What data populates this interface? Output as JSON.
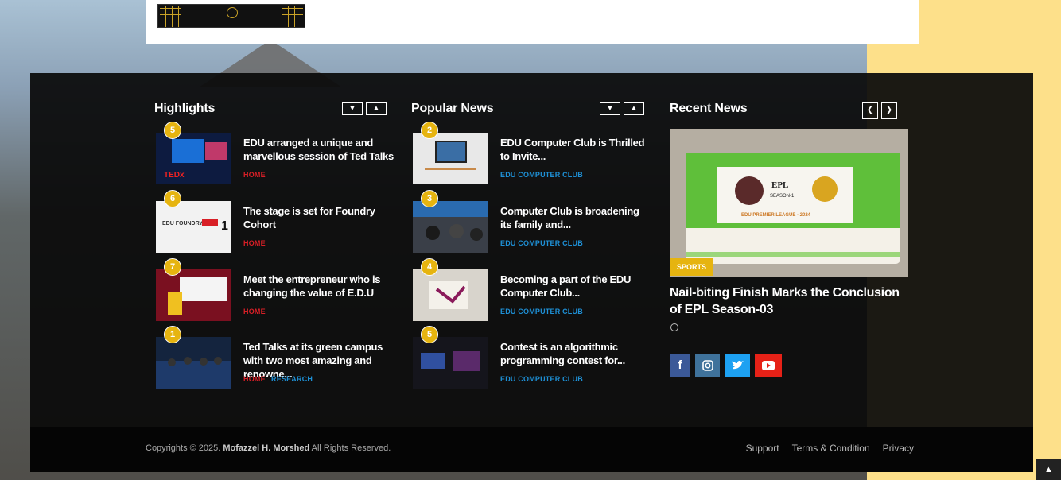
{
  "highlights": {
    "title": "Highlights",
    "items": [
      {
        "badge": "5",
        "title": "EDU arranged a unique and marvellous session of Ted Talks",
        "category": "HOME",
        "category2": ""
      },
      {
        "badge": "6",
        "title": "The stage is set for Foundry Cohort",
        "category": "HOME",
        "category2": ""
      },
      {
        "badge": "7",
        "title": "Meet the entrepreneur who is changing the value of E.D.U",
        "category": "HOME",
        "category2": ""
      },
      {
        "badge": "1",
        "title": "Ted Talks at its green campus with two most amazing and renowne...",
        "category": "HOME",
        "category2": "RESEARCH"
      }
    ]
  },
  "popular": {
    "title": "Popular News",
    "items": [
      {
        "badge": "2",
        "title": "EDU Computer Club is Thrilled to Invite...",
        "category": "EDU COMPUTER CLUB"
      },
      {
        "badge": "3",
        "title": "Computer Club is broadening its family and...",
        "category": "EDU COMPUTER CLUB"
      },
      {
        "badge": "4",
        "title": "Becoming a part of the EDU Computer Club...",
        "category": "EDU COMPUTER CLUB"
      },
      {
        "badge": "5",
        "title": "Contest is an algorithmic programming contest for...",
        "category": "EDU COMPUTER CLUB"
      }
    ]
  },
  "recent": {
    "title": "Recent News",
    "tag": "SPORTS",
    "headline": "Nail-biting Finish Marks the Conclusion of EPL Season-03",
    "cake_text": "EPL",
    "cake_sub": "SEASON-1",
    "cake_banner": "EDU PREMIER LEAGUE - 2024"
  },
  "footer": {
    "copyright_prefix": "Copyrights © 2025.",
    "copyright_name": "Mofazzel H. Morshed",
    "copyright_suffix": "All Rights Reserved.",
    "links": [
      "Support",
      "Terms & Condition",
      "Privacy"
    ]
  },
  "colors": {
    "accent": "#e6b410",
    "home": "#d81f26",
    "club": "#1e90d6"
  }
}
